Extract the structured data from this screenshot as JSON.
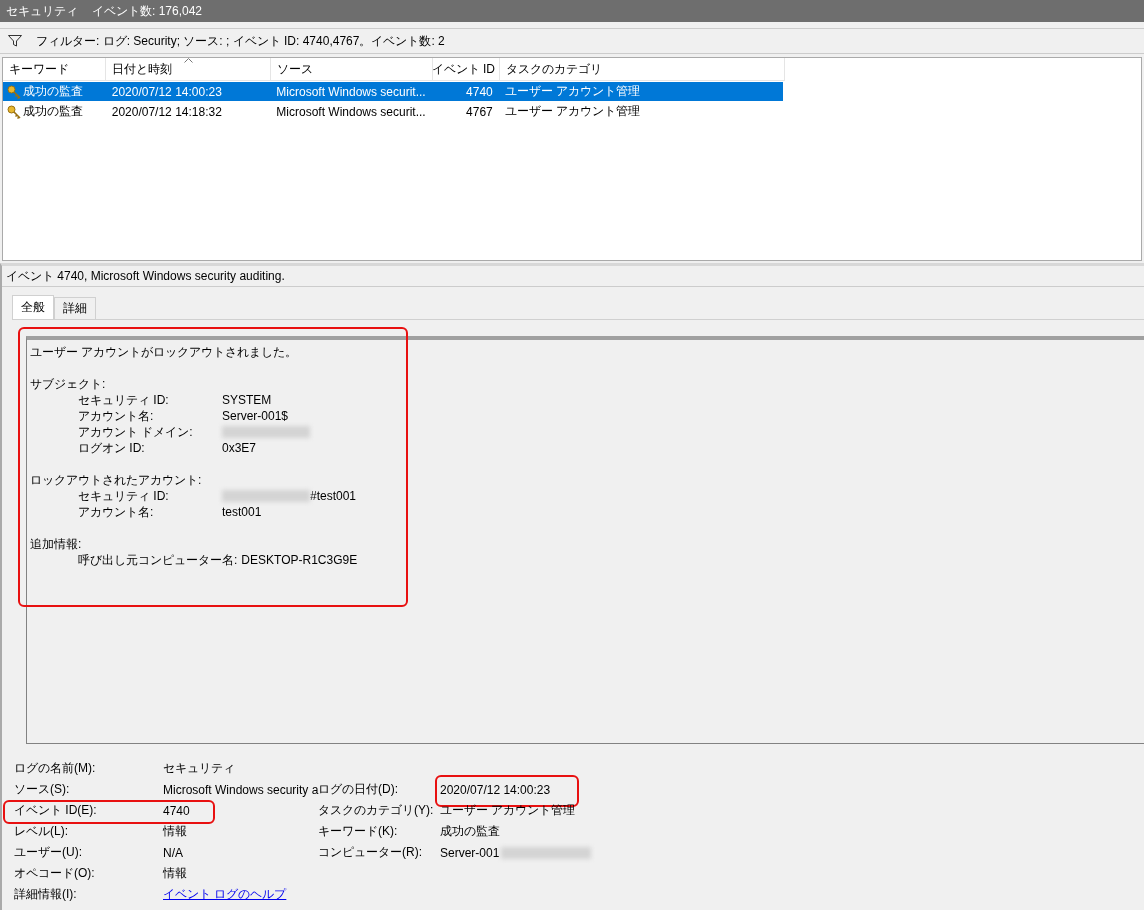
{
  "title_bar": {
    "title": "セキュリティ",
    "count": "イベント数: 176,042"
  },
  "filter": {
    "text": "フィルター: ログ: Security; ソース: ; イベント ID: 4740,4767。イベント数: 2"
  },
  "table": {
    "columns": [
      {
        "label": "キーワード",
        "sorted": false
      },
      {
        "label": "日付と時刻",
        "sorted": true
      },
      {
        "label": "ソース",
        "sorted": false
      },
      {
        "label": "イベント ID",
        "sorted": false
      },
      {
        "label": "タスクのカテゴリ",
        "sorted": false
      }
    ],
    "rows": [
      {
        "keyword": "成功の監査",
        "date": "2020/07/12 14:00:23",
        "source": "Microsoft Windows securit...",
        "event_id": "4740",
        "category": "ユーザー アカウント管理",
        "selected": true
      },
      {
        "keyword": "成功の監査",
        "date": "2020/07/12 14:18:32",
        "source": "Microsoft Windows securit...",
        "event_id": "4767",
        "category": "ユーザー アカウント管理",
        "selected": false
      }
    ]
  },
  "details": {
    "header": "イベント 4740, Microsoft Windows security auditing.",
    "tabs": [
      {
        "label": "全般",
        "selected": true
      },
      {
        "label": "詳細",
        "selected": false
      }
    ],
    "message": {
      "highlighted": true,
      "lines": [
        {
          "kind": "text",
          "text": "ユーザー アカウントがロックアウトされました。"
        },
        {
          "kind": "blank"
        },
        {
          "kind": "heading",
          "text": "サブジェクト:"
        },
        {
          "kind": "field",
          "label": "セキュリティ ID:",
          "value": "SYSTEM",
          "redacted": false
        },
        {
          "kind": "field",
          "label": "アカウント名:",
          "value": "Server-001$",
          "redacted": false
        },
        {
          "kind": "field",
          "label": "アカウント ドメイン:",
          "redacted": true
        },
        {
          "kind": "field",
          "label": "ログオン ID:",
          "value": "0x3E7",
          "redacted": false
        },
        {
          "kind": "blank"
        },
        {
          "kind": "heading",
          "text": "ロックアウトされたアカウント:"
        },
        {
          "kind": "field",
          "label": "セキュリティ ID:",
          "value": "#test001",
          "redacted": true
        },
        {
          "kind": "field",
          "label": "アカウント名:",
          "value": "test001",
          "redacted": false
        },
        {
          "kind": "blank"
        },
        {
          "kind": "heading",
          "text": "追加情報:"
        },
        {
          "kind": "field",
          "label": "呼び出し元コンピューター名:",
          "value": "DESKTOP-R1C3G9E",
          "redacted": false
        }
      ]
    },
    "property_rows": [
      {
        "left": {
          "label": "ログの名前(M):",
          "value": "セキュリティ",
          "highlighted": false,
          "redacted": false
        }
      },
      {
        "left": {
          "label": "ソース(S):",
          "value": "Microsoft Windows security a",
          "highlighted": false,
          "redacted": false
        },
        "right": {
          "label": "ログの日付(D):",
          "value": "2020/07/12 14:00:23",
          "highlighted": true,
          "redacted": false
        }
      },
      {
        "left": {
          "label": "イベント ID(E):",
          "value": "4740",
          "highlighted": true,
          "redacted": false
        },
        "right": {
          "label": "タスクのカテゴリ(Y):",
          "value": "ユーザー アカウント管理",
          "highlighted": false,
          "redacted": false
        }
      },
      {
        "left": {
          "label": "レベル(L):",
          "value": "情報",
          "highlighted": false,
          "redacted": false
        },
        "right": {
          "label": "キーワード(K):",
          "value": "成功の監査",
          "highlighted": false,
          "redacted": false
        }
      },
      {
        "left": {
          "label": "ユーザー(U):",
          "value": "N/A",
          "highlighted": false,
          "redacted": false
        },
        "right": {
          "label": "コンピューター(R):",
          "value": "Server-001",
          "highlighted": false,
          "redacted": true
        }
      },
      {
        "left": {
          "label": "オペコード(O):",
          "value": "情報",
          "highlighted": false,
          "redacted": false
        }
      },
      {
        "left": {
          "label": "詳細情報(I):",
          "link": "イベント ログのヘルプ",
          "highlighted": false,
          "redacted": false
        }
      }
    ]
  }
}
